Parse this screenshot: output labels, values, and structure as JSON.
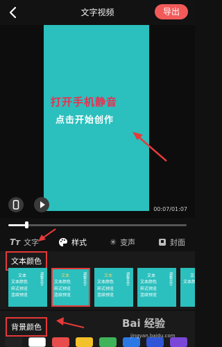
{
  "header": {
    "title": "文字视频",
    "export_label": "导出"
  },
  "video": {
    "line1": "打开手机静音",
    "line2": "点击开始创作",
    "time": "00:07/01:07",
    "progress": 0.1,
    "colors": {
      "background": "#2bbfbd",
      "line1": "#ee2e4f",
      "line2": "#ffffff"
    }
  },
  "tabs": [
    {
      "label": "文字",
      "icon": "text-tt-icon"
    },
    {
      "label": "样式",
      "icon": "palette-icon"
    },
    {
      "label": "变声",
      "icon": "voice-change-icon"
    },
    {
      "label": "封面",
      "icon": "cover-icon"
    }
  ],
  "text_color": {
    "label": "文本颜色",
    "thumbs": [
      {
        "line1": "文本",
        "line2": "文本颜色",
        "line3": "样式预览",
        "line4": "连续预览",
        "side": "调整文字"
      },
      {
        "line1": "文本",
        "line2": "文本颜色",
        "line3": "样式预览",
        "line4": "连续预览",
        "side": "调整文字"
      },
      {
        "line1": "文本",
        "line2": "文本颜色",
        "line3": "样式预览",
        "line4": "连续预览",
        "side": "调整文字"
      },
      {
        "line1": "文本",
        "line2": "文本颜色",
        "line3": "样式预览",
        "line4": "连续预览",
        "side": "调整文字"
      },
      {
        "line1": "文本",
        "line2": "文本颜色",
        "line3": "样式预览",
        "line4": "连续预览",
        "side": "调整文字"
      }
    ]
  },
  "bg_color": {
    "label": "背景颜色",
    "swatches": [
      "#222222",
      "#ffffff",
      "#e84b4b",
      "#f3c12a",
      "#3fb35a",
      "#2c79e6",
      "#2f56d6",
      "#7a47d8"
    ]
  },
  "watermark": {
    "brand": "Bai 经验",
    "url": "jingyan.baidu.com"
  }
}
